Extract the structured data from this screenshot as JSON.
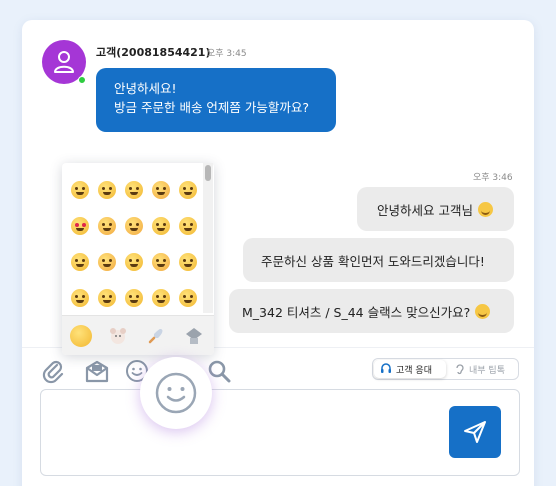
{
  "customer": {
    "name": "고객(20081854421)",
    "time": "오후 3:45",
    "message_lines": [
      "안녕하세요!",
      "방금 주문한 배송 언제쯤 가능할까요?"
    ]
  },
  "agent": {
    "time": "오후 3:46",
    "messages": [
      "안녕하세요 고객님",
      "주문하신 상품 확인먼저 도와드리겠습니다!",
      "M_342 티셔츠 / S_44 슬랙스 맞으신가요?"
    ]
  },
  "toolbar": {
    "icons": [
      "attachment-icon",
      "template-icon",
      "emoji-icon",
      "search-icon"
    ],
    "mode_active": "고객 응대",
    "mode_inactive": "내부 팁톡"
  },
  "composer": {
    "placeholder": ""
  },
  "emoji_picker": {
    "categories": [
      "smileys-icon",
      "animals-icon",
      "travel-icon",
      "objects-icon"
    ]
  },
  "colors": {
    "accent": "#1670c7",
    "avatar": "#a536d6",
    "online": "#2ecc40",
    "bubble_grey": "#ebebeb",
    "background": "#e9f1fb"
  }
}
